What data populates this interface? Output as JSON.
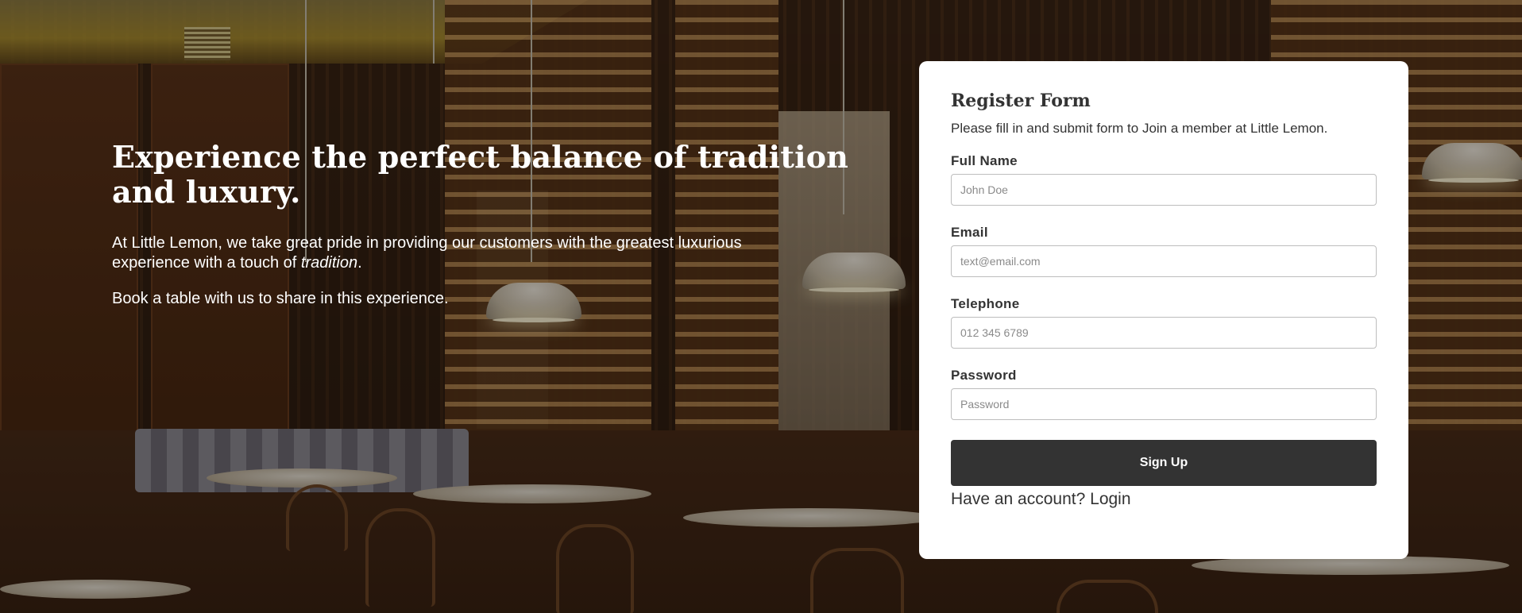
{
  "hero": {
    "title": "Experience the perfect balance of tradition and luxury.",
    "paragraph1_before": "At Little Lemon, we take great pride in providing our customers with the greatest luxurious experience with a touch of ",
    "paragraph1_emphasis": "tradition",
    "paragraph1_after": ".",
    "paragraph2": "Book a table with us to share in this experience."
  },
  "form": {
    "title": "Register Form",
    "subtitle": "Please fill in and submit form to Join a member at Little Lemon.",
    "fields": [
      {
        "label": "Full Name",
        "placeholder": "John Doe",
        "value": ""
      },
      {
        "label": "Email",
        "placeholder": "text@email.com",
        "value": ""
      },
      {
        "label": "Telephone",
        "placeholder": "012 345 6789",
        "value": ""
      },
      {
        "label": "Password",
        "placeholder": "Password",
        "value": ""
      }
    ],
    "submit_label": "Sign Up",
    "account_prompt": "Have an account?",
    "login_label": "Login"
  },
  "colors": {
    "card_background": "#ffffff",
    "button_background": "#333333",
    "text_dark": "#333333",
    "hero_text": "#ffffff"
  }
}
